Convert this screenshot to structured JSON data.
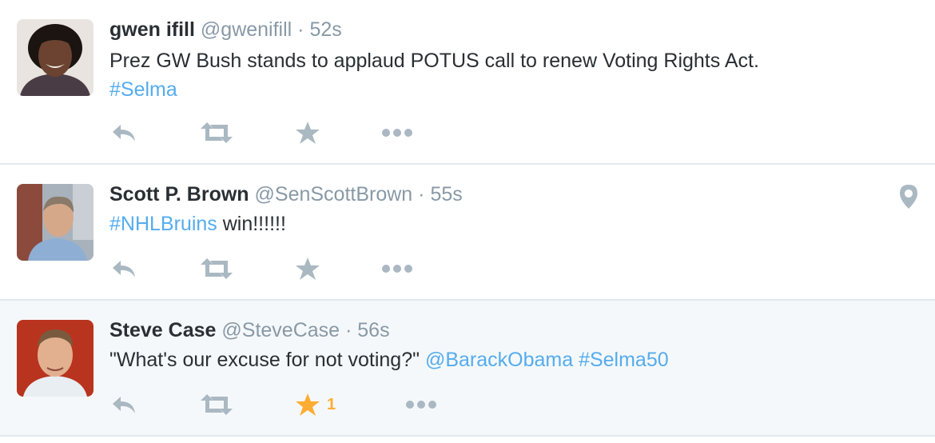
{
  "tweets": [
    {
      "name": "gwen ifill",
      "handle": "@gwenifill",
      "sep": " · ",
      "time": "52s",
      "text_main": "Prez GW Bush stands to applaud POTUS call to renew Voting Rights Act.",
      "hashtag": "#Selma"
    },
    {
      "name": "Scott P. Brown",
      "handle": "@SenScottBrown",
      "sep": " · ",
      "time": "55s",
      "hashtag": "#NHLBruins",
      "text_after": " win!!!!!!"
    },
    {
      "name": "Steve Case",
      "handle": "@SteveCase",
      "sep": " · ",
      "time": "56s",
      "text_quote": "\"What's our excuse for not voting?\" ",
      "mention": "@BarackObama",
      "space": " ",
      "hashtag": "#Selma50",
      "favorite_count": "1"
    }
  ],
  "colors": {
    "link": "#55acee",
    "muted": "#8899a6",
    "action_icon": "#aab8c2",
    "favorited": "#ffac33",
    "highlight_bg": "#f5f8fa"
  },
  "icons": [
    "reply-icon",
    "retweet-icon",
    "favorite-star-icon",
    "more-dots-icon",
    "location-pin-icon"
  ]
}
